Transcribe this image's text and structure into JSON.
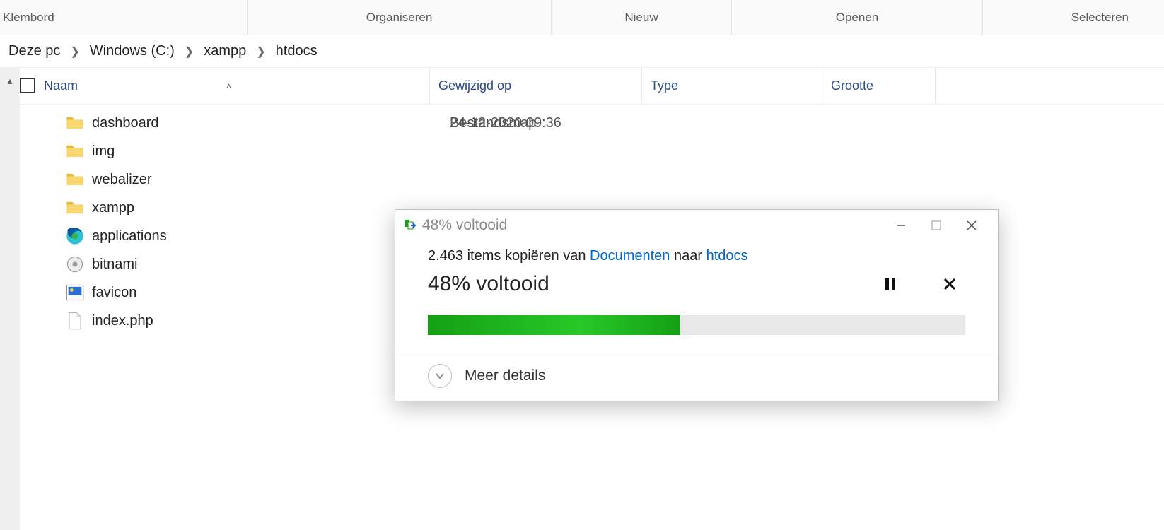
{
  "ribbon": {
    "sections": [
      "Klembord",
      "Organiseren",
      "Nieuw",
      "Openen",
      "Selecteren"
    ]
  },
  "breadcrumb": {
    "parts": [
      "Deze pc",
      "Windows (C:)",
      "xampp",
      "htdocs"
    ]
  },
  "columns": {
    "name": "Naam",
    "modified": "Gewijzigd op",
    "type": "Type",
    "size": "Grootte"
  },
  "files": [
    {
      "icon": "folder",
      "name": "dashboard",
      "modified": "24-12-2020 09:36",
      "type": "Bestandsmap"
    },
    {
      "icon": "folder",
      "name": "img"
    },
    {
      "icon": "folder",
      "name": "webalizer"
    },
    {
      "icon": "folder",
      "name": "xampp"
    },
    {
      "icon": "edge",
      "name": "applications"
    },
    {
      "icon": "gear",
      "name": "bitnami"
    },
    {
      "icon": "image",
      "name": "favicon"
    },
    {
      "icon": "doc",
      "name": "index.php"
    }
  ],
  "dialog": {
    "title": "48% voltooid",
    "line_prefix": "2.463 items kopiëren van ",
    "source": "Documenten",
    "line_mid": " naar ",
    "dest": "htdocs",
    "big": "48% voltooid",
    "progress_percent": 47,
    "more": "Meer details"
  }
}
